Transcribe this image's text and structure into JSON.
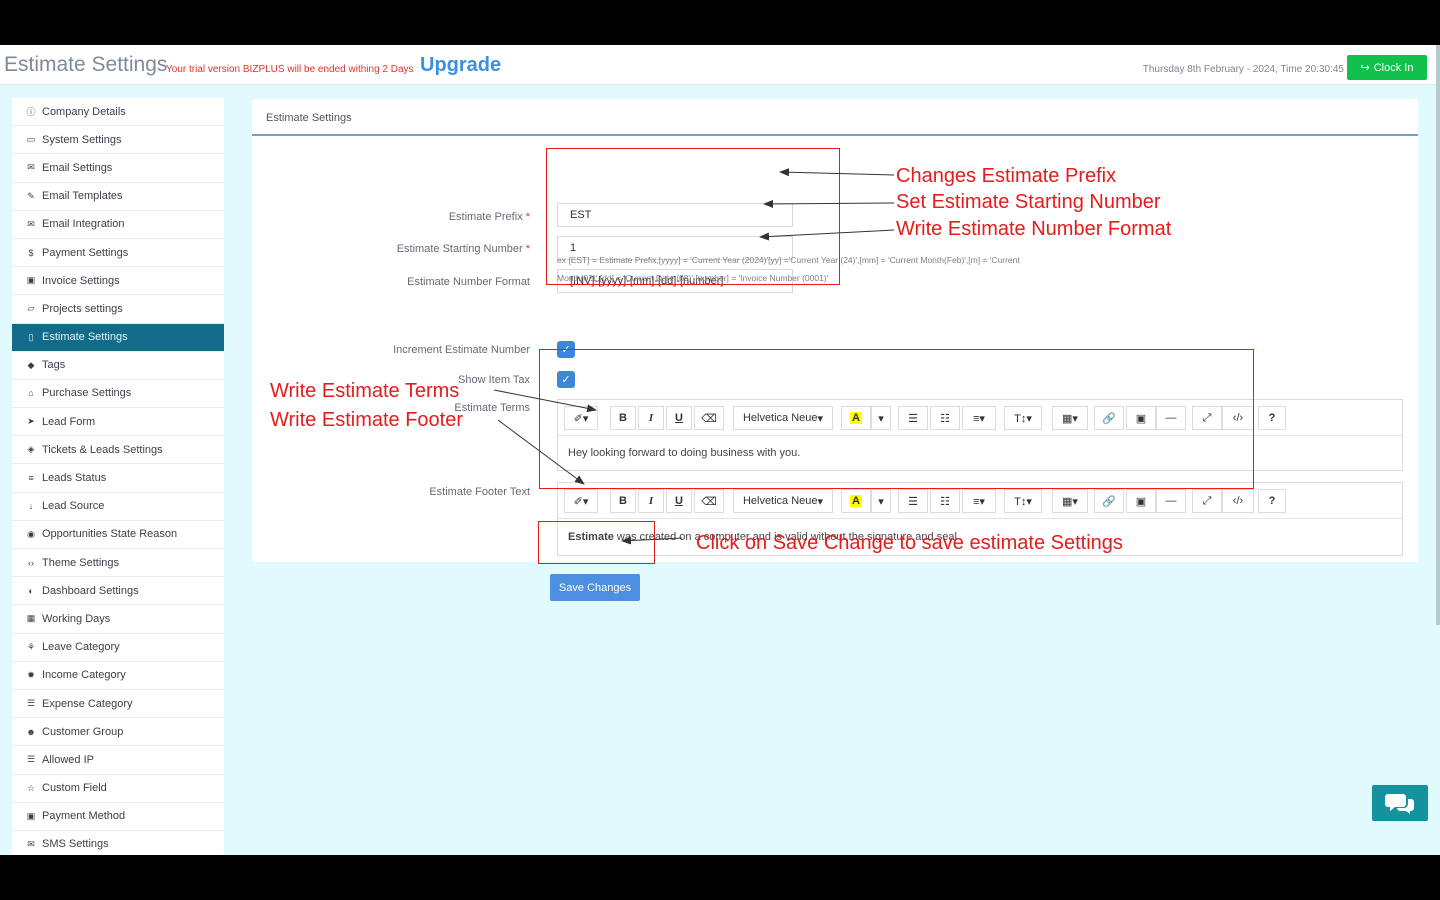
{
  "header": {
    "title": "Estimate Settings",
    "trial_note": "Your trial version BIZPLUS will be ended withing 2 Days",
    "upgrade": "Upgrade",
    "datetime": "Thursday 8th February - 2024,  Time  20:30:45",
    "clock_in": "Clock In"
  },
  "sidebar": {
    "items": [
      {
        "label": "Company Details",
        "icon": "info-icon"
      },
      {
        "label": "System Settings",
        "icon": "desktop-icon"
      },
      {
        "label": "Email Settings",
        "icon": "envelope-icon"
      },
      {
        "label": "Email Templates",
        "icon": "edit-icon"
      },
      {
        "label": "Email Integration",
        "icon": "envelope-outline-icon"
      },
      {
        "label": "Payment Settings",
        "icon": "dollar-icon"
      },
      {
        "label": "Invoice Settings",
        "icon": "money-icon"
      },
      {
        "label": "Projects settings",
        "icon": "folder-icon"
      },
      {
        "label": "Estimate Settings",
        "icon": "file-icon"
      },
      {
        "label": "Tags",
        "icon": "tag-icon"
      },
      {
        "label": "Purchase Settings",
        "icon": "lock-icon"
      },
      {
        "label": "Lead Form",
        "icon": "send-icon"
      },
      {
        "label": "Tickets & Leads Settings",
        "icon": "ticket-icon"
      },
      {
        "label": "Leads Status",
        "icon": "list-icon"
      },
      {
        "label": "Lead Source",
        "icon": "arrow-down-icon"
      },
      {
        "label": "Opportunities State Reason",
        "icon": "circle-dot-icon"
      },
      {
        "label": "Theme Settings",
        "icon": "code-icon"
      },
      {
        "label": "Dashboard Settings",
        "icon": "dashboard-icon"
      },
      {
        "label": "Working Days",
        "icon": "calendar-icon"
      },
      {
        "label": "Leave Category",
        "icon": "leave-icon"
      },
      {
        "label": "Income Category",
        "icon": "certificate-icon"
      },
      {
        "label": "Expense Category",
        "icon": "tasks-icon"
      },
      {
        "label": "Customer Group",
        "icon": "users-icon"
      },
      {
        "label": "Allowed IP",
        "icon": "server-icon"
      },
      {
        "label": "Custom Field",
        "icon": "star-icon"
      },
      {
        "label": "Payment Method",
        "icon": "money-icon"
      },
      {
        "label": "SMS Settings",
        "icon": "envelope-icon"
      }
    ],
    "active_index": 8
  },
  "panel": {
    "title": "Estimate Settings",
    "prefix_label": "Estimate Prefix",
    "prefix_value": "EST",
    "start_label": "Estimate Starting Number",
    "start_value": "1",
    "format_label": "Estimate Number Format",
    "format_value": "[INV]-[yyyy]-[mm]-[dd]-[number]",
    "format_help": "ex [EST] = Estimate Prefix,[yyyy] = 'Current Year (2024)'[yy] ='Current Year (24)',[mm] = 'Current Month(Feb)',[m] = 'Current Month(02)',[dd] = 'Current Date (08)',[number] = 'Invoice Number (0001)'",
    "required_mark": "*",
    "increment_label": "Increment Estimate Number",
    "increment_checked": true,
    "item_tax_label": "Show Item Tax",
    "item_tax_checked": true,
    "terms_label": "Estimate Terms",
    "terms_value": "Hey looking forward to doing business with you.",
    "footer_label": "Estimate Footer Text",
    "footer_bold": "Estimate",
    "footer_rest": " was created on a computer and is valid without the signature and seal",
    "save_label": "Save Changes"
  },
  "toolbar": {
    "font": "Helvetica Neue",
    "bold": "B",
    "italic": "I",
    "underline": "U",
    "color_letter": "A",
    "help": "?"
  },
  "annotations": {
    "prefix_note": "Changes Estimate Prefix",
    "start_note": "Set Estimate Starting Number",
    "format_note": "Write Estimate Number Format",
    "terms_note": "Write Estimate Terms",
    "footer_note": "Write Estimate Footer",
    "save_note": "Click on Save Change to save estimate Settings"
  },
  "colors": {
    "active_sidebar": "#136b8a",
    "annotation_red": "#e41c1c",
    "clock_in_green": "#10c24b",
    "save_blue": "#4c8fe0",
    "upgrade_blue": "#3d8fe0"
  }
}
